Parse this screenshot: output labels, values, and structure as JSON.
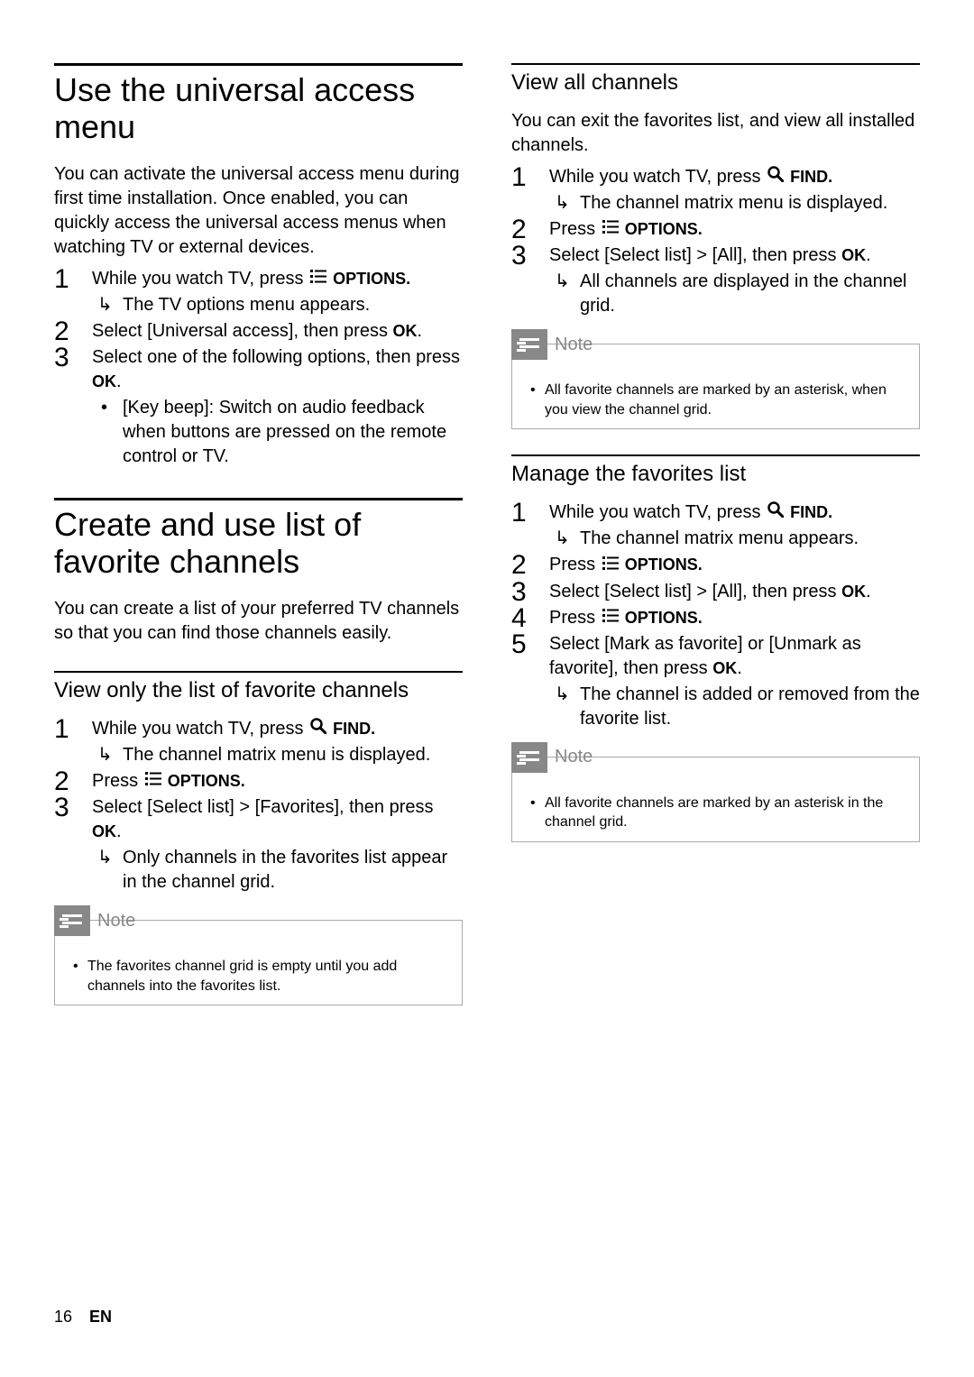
{
  "col1": {
    "section1": {
      "title": "Use the universal access menu",
      "intro": "You can activate the universal access menu during first time installation. Once enabled, you can quickly access the universal access menus when watching TV or external devices.",
      "step1_a": "While you watch TV, press ",
      "step1_b": " OPTIONS.",
      "step1_sub": "The TV options menu appears.",
      "step2_a": "Select ",
      "step2_b": "[Universal access]",
      "step2_c": ", then press ",
      "step2_d": "OK",
      "step2_e": ".",
      "step3_a": "Select one of the following options, then press ",
      "step3_b": "OK",
      "step3_c": ".",
      "step3_bullet_a": "[Key beep]",
      "step3_bullet_b": ": Switch on audio feedback when buttons are pressed on the remote control or TV."
    },
    "section2": {
      "title": "Create and use list of favorite channels",
      "intro": "You can create a list of your preferred TV channels so that you can find those channels easily.",
      "sub_title": "View only the list of favorite channels",
      "step1_a": "While you watch TV, press ",
      "step1_b": " FIND.",
      "step1_sub": "The channel matrix menu is displayed.",
      "step2_a": "Press ",
      "step2_b": " OPTIONS.",
      "step3_a": "Select ",
      "step3_b": "[Select list]",
      "step3_c": " > ",
      "step3_d": "[Favorites]",
      "step3_e": ", then press ",
      "step3_f": "OK",
      "step3_g": ".",
      "step3_sub": "Only channels in the favorites list appear in the channel grid.",
      "note_label": "Note",
      "note_text": "The favorites channel grid is empty until you add channels into the favorites list."
    }
  },
  "col2": {
    "section1": {
      "title": "View all channels",
      "intro": "You can exit the favorites list, and view all installed channels.",
      "step1_a": "While you watch TV, press ",
      "step1_b": " FIND.",
      "step1_sub": "The channel matrix menu is displayed.",
      "step2_a": "Press ",
      "step2_b": " OPTIONS.",
      "step3_a": "Select ",
      "step3_b": "[Select list]",
      "step3_c": " > ",
      "step3_d": "[All]",
      "step3_e": ", then press ",
      "step3_f": "OK",
      "step3_g": ".",
      "step3_sub": "All channels are displayed in the channel grid.",
      "note_label": "Note",
      "note_text": "All favorite channels are marked by an asterisk, when you view the channel grid."
    },
    "section2": {
      "title": "Manage the favorites list",
      "step1_a": "While you watch TV, press ",
      "step1_b": " FIND.",
      "step1_sub": "The channel matrix menu appears.",
      "step2_a": "Press ",
      "step2_b": " OPTIONS.",
      "step3_a": "Select ",
      "step3_b": "[Select list]",
      "step3_c": " > ",
      "step3_d": "[All]",
      "step3_e": ", then press ",
      "step3_f": "OK",
      "step3_g": ".",
      "step4_a": "Press ",
      "step4_b": " OPTIONS.",
      "step5_a": "Select ",
      "step5_b": "[Mark as favorite]",
      "step5_c": " or ",
      "step5_d": "[Unmark as favorite]",
      "step5_e": ", then press ",
      "step5_f": "OK",
      "step5_g": ".",
      "step5_sub": "The channel is added or removed from the favorite list.",
      "note_label": "Note",
      "note_text": "All favorite channels are marked by an asterisk in the channel grid."
    }
  },
  "footer": {
    "page": "16",
    "lang": "EN"
  }
}
